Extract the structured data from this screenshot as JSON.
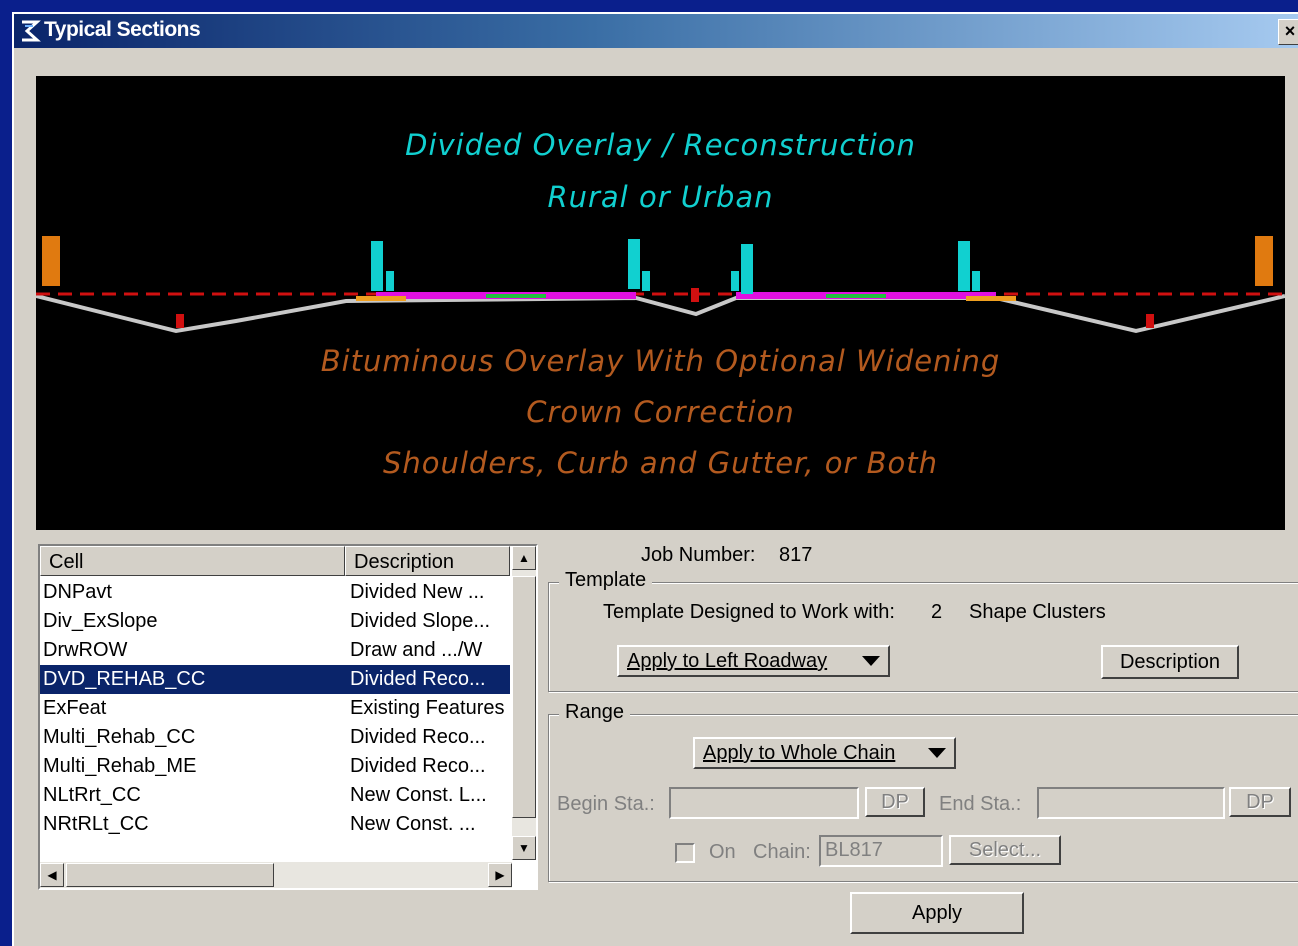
{
  "window": {
    "title": "Typical Sections",
    "close_glyph": "×"
  },
  "preview": {
    "line1": "Divided Overlay / Reconstruction",
    "line2": "Rural or Urban",
    "line3": "Bituminous Overlay With Optional Widening",
    "line4": "Crown Correction",
    "line5": "Shoulders,  Curb and Gutter, or Both",
    "colors": {
      "title_text": "#11d0d0",
      "desc_text": "#b35a1f",
      "baseline": "#d01010",
      "ground": "#c8c8c8",
      "pavement": "#e010e0"
    }
  },
  "cell_list": {
    "headers": {
      "cell": "Cell",
      "description": "Description"
    },
    "rows": [
      {
        "cell": "DNPavt",
        "description": "Divided New ..."
      },
      {
        "cell": "Div_ExSlope",
        "description": "Divided Slope..."
      },
      {
        "cell": "DrwROW",
        "description": "Draw and .../W"
      },
      {
        "cell": "DVD_REHAB_CC",
        "description": "Divided Reco..."
      },
      {
        "cell": "ExFeat",
        "description": "Existing Features"
      },
      {
        "cell": "Multi_Rehab_CC",
        "description": "Divided Reco..."
      },
      {
        "cell": "Multi_Rehab_ME",
        "description": "Divided Reco..."
      },
      {
        "cell": "NLtRrt_CC",
        "description": "New Const. L..."
      },
      {
        "cell": "NRtRLt_CC",
        "description": "New Const. ..."
      }
    ],
    "selected_cell": "DVD_REHAB_CC",
    "selection_color": "#0a246a"
  },
  "job": {
    "label": "Job Number:",
    "value": "817"
  },
  "template": {
    "group_label": "Template",
    "designed_label": "Template Designed to Work with:",
    "clusters_count": "2",
    "clusters_label": "Shape Clusters",
    "apply_dropdown": "Apply to Left Roadway",
    "description_button": "Description"
  },
  "range": {
    "group_label": "Range",
    "apply_dropdown": "Apply to Whole Chain",
    "begin_label": "Begin Sta.:",
    "dp_label": "DP",
    "end_label": "End Sta.:",
    "on_label": "On",
    "chain_label": "Chain:",
    "chain_value": "BL817",
    "select_button": "Select..."
  },
  "apply_button": "Apply"
}
